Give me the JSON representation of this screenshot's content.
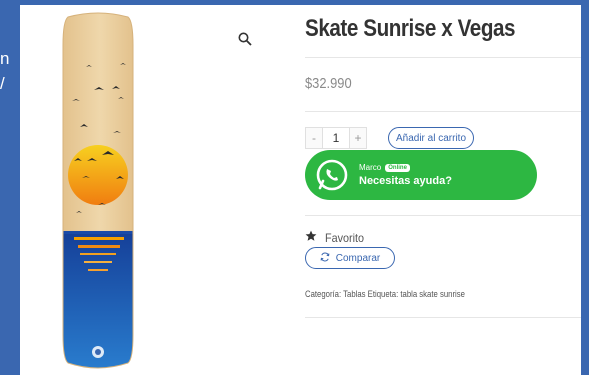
{
  "left_edge": {
    "line1": "n",
    "line2": "/"
  },
  "product": {
    "title": "Skate Sunrise x Vegas",
    "price": "$32.990",
    "quantity": {
      "minus": "-",
      "value": "1",
      "plus": "+"
    },
    "add_to_cart_label": "Añadir al carrito",
    "favorite_label": "Favorito",
    "compare_label": "Comparar",
    "meta_text": "Categoría: Tablas Etiqueta: tabla skate sunrise"
  },
  "whatsapp": {
    "agent_name": "Marco",
    "status_badge": "Online",
    "message": "Necesitas ayuda?"
  },
  "icons": {
    "zoom": "magnifier-icon",
    "whatsapp": "whatsapp-icon",
    "favorite": "star-icon",
    "compare": "refresh-icon"
  },
  "colors": {
    "page_background": "#3a67b0",
    "accent": "#3a67b0",
    "whatsapp_green": "#2db742",
    "board_wood": "#e8cfa0",
    "board_sea": "#1a5ab0",
    "sun": "#f5a800"
  }
}
